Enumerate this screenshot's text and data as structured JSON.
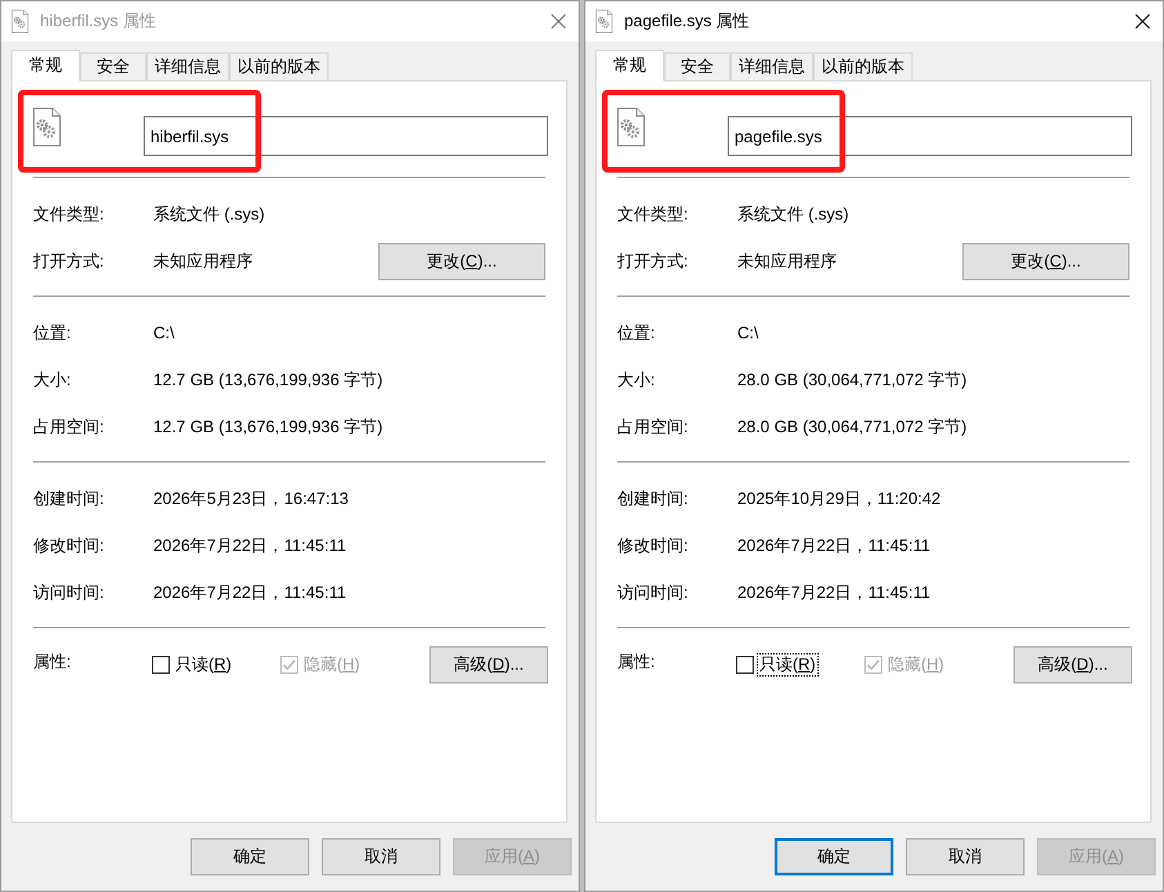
{
  "windows": [
    {
      "title": "hiberfil.sys 属性",
      "active": false,
      "tabs": [
        {
          "label": "常规",
          "selected": true
        },
        {
          "label": "安全",
          "selected": false
        },
        {
          "label": "详细信息",
          "selected": false
        },
        {
          "label": "以前的版本",
          "selected": false
        }
      ],
      "file_name": "hiberfil.sys",
      "name_highlighted": true,
      "sections": [
        {
          "rows": [
            {
              "label": "文件类型:",
              "value": "系统文件 (.sys)"
            },
            {
              "label": "打开方式:",
              "value": "未知应用程序",
              "button": {
                "label": "更改(",
                "access_key": "C",
                "label_end": ")..."
              }
            }
          ]
        },
        {
          "rows": [
            {
              "label": "位置:",
              "value": "C:\\"
            },
            {
              "label": "大小:",
              "value": "12.7 GB (13,676,199,936 字节)"
            },
            {
              "label": "占用空间:",
              "value": "12.7 GB (13,676,199,936 字节)"
            }
          ]
        },
        {
          "rows": [
            {
              "label": "创建时间:",
              "value": "2026年5月23日，16:47:13"
            },
            {
              "label": "修改时间:",
              "value": "2026年7月22日，11:45:11"
            },
            {
              "label": "访问时间:",
              "value": "2026年7月22日，11:45:11"
            }
          ]
        }
      ],
      "attributes": {
        "label": "属性:",
        "checkboxes": [
          {
            "label": "只读(",
            "access_key": "R",
            "label_end": ")",
            "checked": false,
            "disabled": false,
            "focused": false
          },
          {
            "label": "隐藏(",
            "access_key": "H",
            "label_end": ")",
            "checked": true,
            "disabled": true,
            "focused": false
          }
        ],
        "button": {
          "label": "高级(",
          "access_key": "D",
          "label_end": ")..."
        }
      },
      "buttons": [
        {
          "label": "确定",
          "default": false,
          "disabled": false
        },
        {
          "label": "取消",
          "default": false,
          "disabled": false
        },
        {
          "label": "应用(",
          "access_key": "A",
          "label_end": ")",
          "default": false,
          "disabled": true
        }
      ]
    },
    {
      "title": "pagefile.sys 属性",
      "active": true,
      "tabs": [
        {
          "label": "常规",
          "selected": true
        },
        {
          "label": "安全",
          "selected": false
        },
        {
          "label": "详细信息",
          "selected": false
        },
        {
          "label": "以前的版本",
          "selected": false
        }
      ],
      "file_name": "pagefile.sys",
      "name_highlighted": true,
      "sections": [
        {
          "rows": [
            {
              "label": "文件类型:",
              "value": "系统文件 (.sys)"
            },
            {
              "label": "打开方式:",
              "value": "未知应用程序",
              "button": {
                "label": "更改(",
                "access_key": "C",
                "label_end": ")..."
              }
            }
          ]
        },
        {
          "rows": [
            {
              "label": "位置:",
              "value": "C:\\"
            },
            {
              "label": "大小:",
              "value": "28.0 GB (30,064,771,072 字节)"
            },
            {
              "label": "占用空间:",
              "value": "28.0 GB (30,064,771,072 字节)"
            }
          ]
        },
        {
          "rows": [
            {
              "label": "创建时间:",
              "value": "2025年10月29日，11:20:42"
            },
            {
              "label": "修改时间:",
              "value": "2026年7月22日，11:45:11"
            },
            {
              "label": "访问时间:",
              "value": "2026年7月22日，11:45:11"
            }
          ]
        }
      ],
      "attributes": {
        "label": "属性:",
        "checkboxes": [
          {
            "label": "只读(",
            "access_key": "R",
            "label_end": ")",
            "checked": false,
            "disabled": false,
            "focused": true
          },
          {
            "label": "隐藏(",
            "access_key": "H",
            "label_end": ")",
            "checked": true,
            "disabled": true,
            "focused": false
          }
        ],
        "button": {
          "label": "高级(",
          "access_key": "D",
          "label_end": ")..."
        }
      },
      "buttons": [
        {
          "label": "确定",
          "default": true,
          "disabled": false
        },
        {
          "label": "取消",
          "default": false,
          "disabled": false
        },
        {
          "label": "应用(",
          "access_key": "A",
          "label_end": ")",
          "default": false,
          "disabled": true
        }
      ]
    }
  ]
}
